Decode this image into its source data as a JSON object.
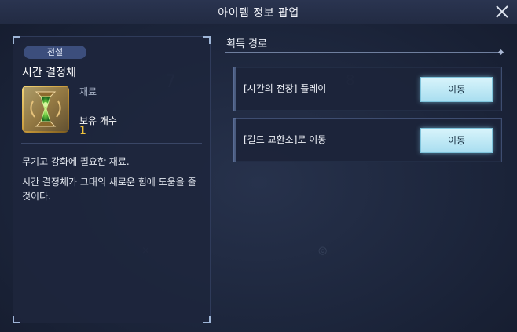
{
  "header": {
    "title": "아이템 정보 팝업",
    "close_icon": "close-icon"
  },
  "item": {
    "grade": "전설",
    "name": "시간 결정체",
    "type": "재료",
    "owned_label": "보유 개수",
    "owned_count": "1",
    "icon": "hourglass-crystal-icon",
    "description_1": "무기고 강화에 필요한 재료.",
    "description_2": "시간 결정체가 그대의 새로운 힘에 도움을 줄 것이다."
  },
  "acquisition": {
    "title": "획득 경로",
    "routes": [
      {
        "label": "[시간의 전장] 플레이",
        "button": "이동"
      },
      {
        "label": "[길드 교환소]로 이동",
        "button": "이동"
      }
    ]
  },
  "colors": {
    "grade_badge": "#3c4e7c",
    "count": "#f0c23c",
    "button": "#b8e6f4"
  }
}
